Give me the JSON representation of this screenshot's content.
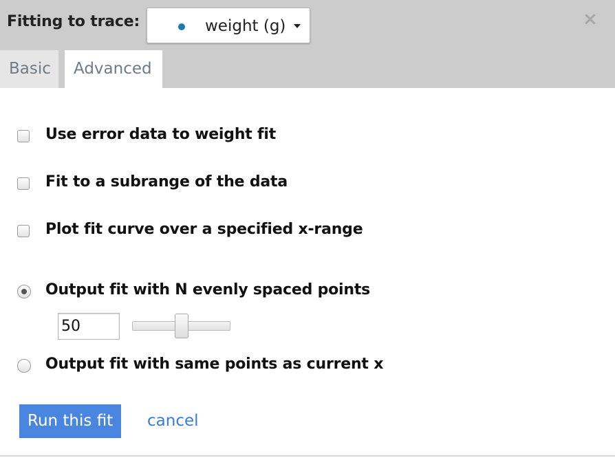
{
  "header": {
    "label": "Fitting to trace:",
    "trace": {
      "name": "weight (g)",
      "marker_color": "#1f77b4",
      "marker_icon": "dot-icon"
    },
    "close_icon": "close-icon"
  },
  "tabs": [
    {
      "label": "Basic",
      "active": false
    },
    {
      "label": "Advanced",
      "active": true
    }
  ],
  "options": {
    "error_weight": {
      "label": "Use error data to weight fit",
      "checked": false
    },
    "subrange": {
      "label": "Fit to a subrange of the data",
      "checked": false
    },
    "x_range": {
      "label": "Plot fit curve over a specified x-range",
      "checked": false
    },
    "output_mode": {
      "n_points": {
        "label": "Output fit with N evenly spaced points",
        "selected": true
      },
      "same_x": {
        "label": "Output fit with same points as current x",
        "selected": false
      }
    },
    "n_points_value": "50"
  },
  "actions": {
    "run_label": "Run this fit",
    "cancel_label": "cancel"
  },
  "colors": {
    "header_bg": "#cccccc",
    "primary_button": "#4a86e0",
    "link": "#3a7bd5"
  }
}
